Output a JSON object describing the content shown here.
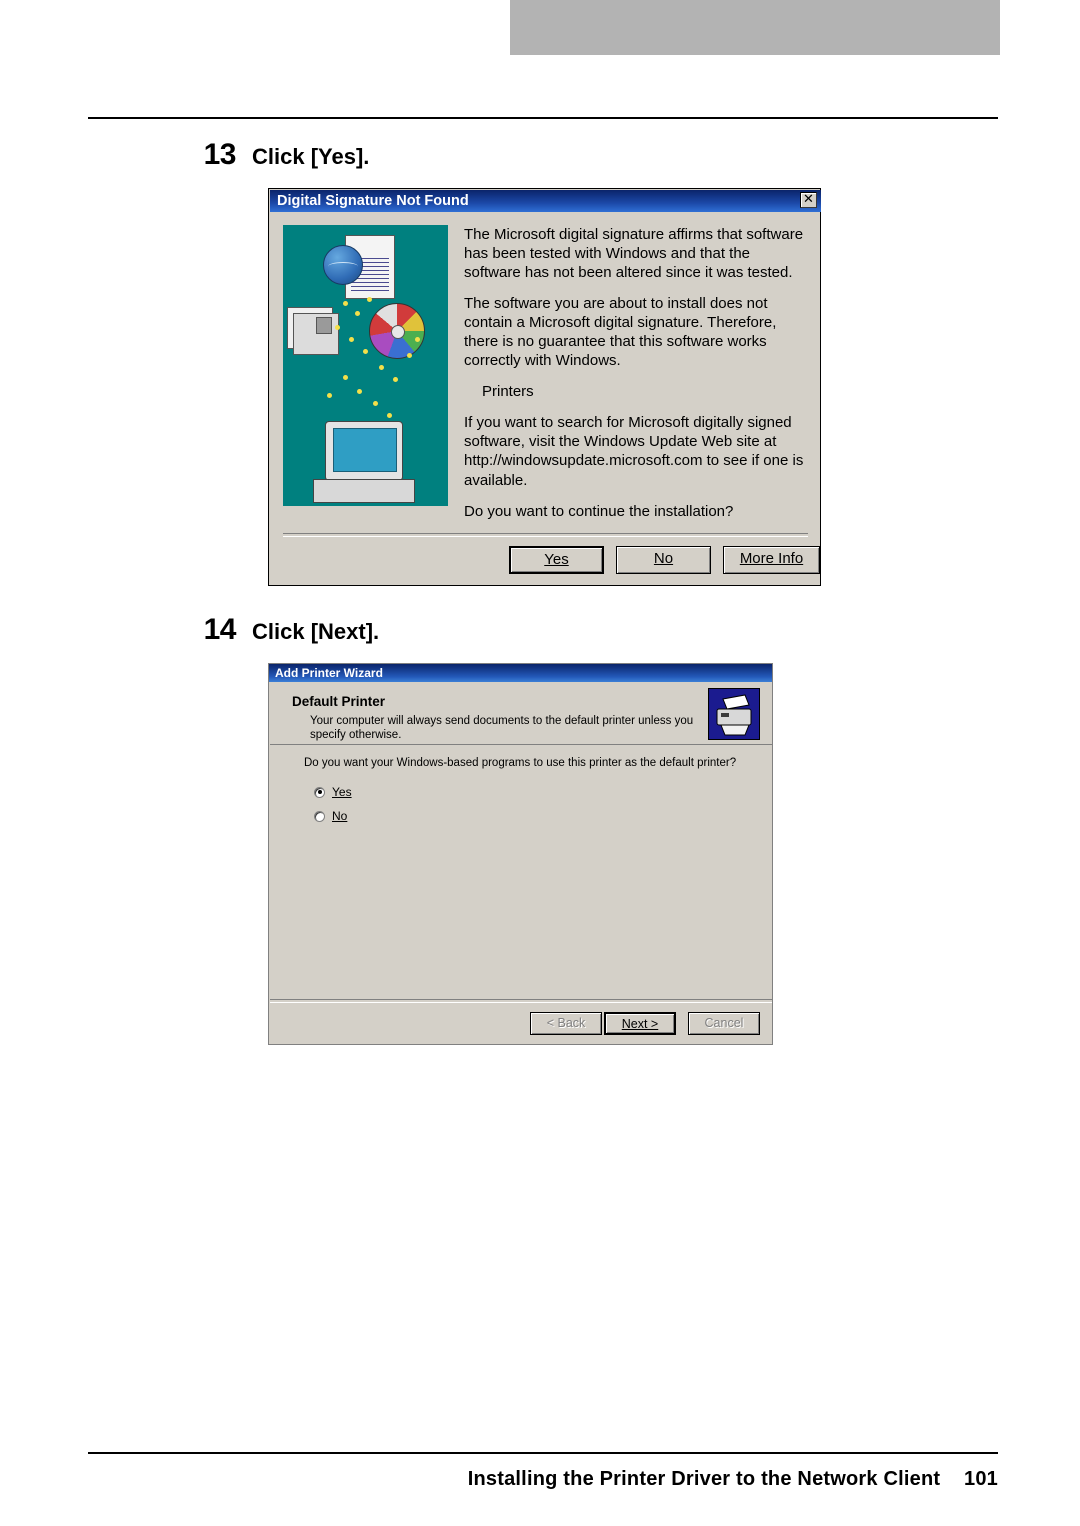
{
  "page": {
    "footer_text": "Installing the Printer Driver to the Network Client",
    "page_number": "101"
  },
  "steps": [
    {
      "number": "13",
      "text": "Click [Yes]."
    },
    {
      "number": "14",
      "text": "Click [Next]."
    }
  ],
  "dialog_signature": {
    "title": "Digital Signature Not Found",
    "close_label": "✕",
    "paragraphs": [
      "The Microsoft digital signature affirms that software has been tested with Windows and that the software has not been altered since it was tested.",
      "The software you are about to install does not contain a Microsoft digital signature. Therefore, there is no guarantee that this software works correctly with Windows.",
      "Printers",
      "If you want to search for Microsoft digitally signed software, visit the Windows Update Web site at http://windowsupdate.microsoft.com to see if one is available.",
      "Do you want to continue the installation?"
    ],
    "buttons": {
      "yes": "Yes",
      "no": "No",
      "more_info": "More Info"
    }
  },
  "dialog_wizard": {
    "title": "Add Printer Wizard",
    "heading": "Default Printer",
    "subheading": "Your computer will always send documents to the default printer unless you specify otherwise.",
    "question": "Do you want your Windows-based programs to use this printer as the default printer?",
    "options": [
      {
        "label": "Yes",
        "selected": true
      },
      {
        "label": "No",
        "selected": false
      }
    ],
    "buttons": {
      "back": "< Back",
      "next": "Next >",
      "cancel": "Cancel"
    }
  },
  "colors": {
    "titlebar_blue": "#0a246a",
    "dialog_face": "#d4d0c8",
    "illustration_teal": "#00807f",
    "header_band": "#b3b3b3"
  }
}
